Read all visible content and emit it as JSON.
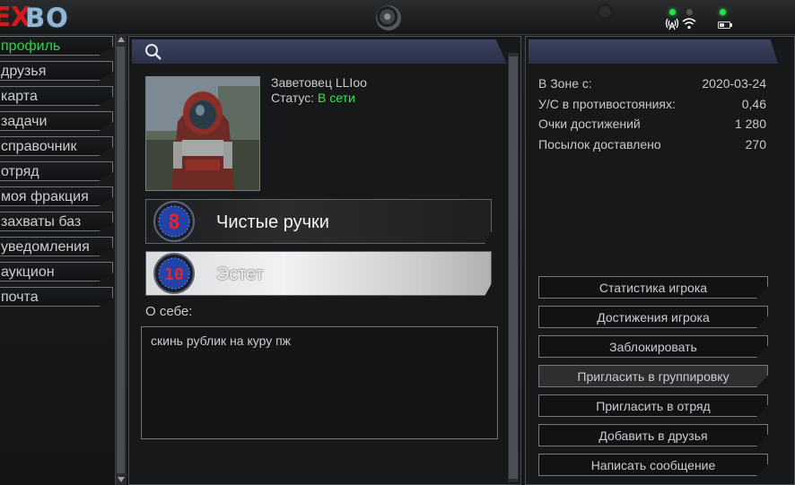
{
  "logo": {
    "ex": "EX",
    "bo": "BO"
  },
  "sidebar": {
    "items": [
      {
        "label": "профиль",
        "active": true
      },
      {
        "label": "друзья"
      },
      {
        "label": "карта"
      },
      {
        "label": "задачи"
      },
      {
        "label": "справочник"
      },
      {
        "label": "отряд"
      },
      {
        "label": "моя фракция"
      },
      {
        "label": "захваты баз"
      },
      {
        "label": "уведомления"
      },
      {
        "label": "аукцион"
      },
      {
        "label": "почта"
      }
    ]
  },
  "profile": {
    "name": "Заветовец LLIoo",
    "status_label": "Статус: ",
    "status_value": "В сети",
    "status_color": "#2fe84d",
    "achievements": [
      {
        "title": "Чистые ручки",
        "badge_number": "8",
        "style": "dark"
      },
      {
        "title": "Эстет",
        "badge_number": "10",
        "style": "light"
      }
    ],
    "about_label": "О себе:",
    "about_text": "скинь рублик на куру пж"
  },
  "stats": [
    {
      "label": "В Зоне с:",
      "value": "2020-03-24"
    },
    {
      "label": "У/С в противостояниях:",
      "value": "0,46"
    },
    {
      "label": "Очки достижений",
      "value": "1 280"
    },
    {
      "label": "Посылок доставлено",
      "value": "270"
    }
  ],
  "actions": [
    {
      "label": "Статистика игрока"
    },
    {
      "label": "Достижения игрока"
    },
    {
      "label": "Заблокировать"
    },
    {
      "label": "Пригласить в группировку",
      "hover": true
    },
    {
      "label": "Пригласить в отряд"
    },
    {
      "label": "Добавить в друзья"
    },
    {
      "label": "Написать сообщение"
    }
  ],
  "colors": {
    "accent_green": "#2ed24c",
    "header_blue": "#3c4360",
    "logo_red": "#d21a1a"
  }
}
